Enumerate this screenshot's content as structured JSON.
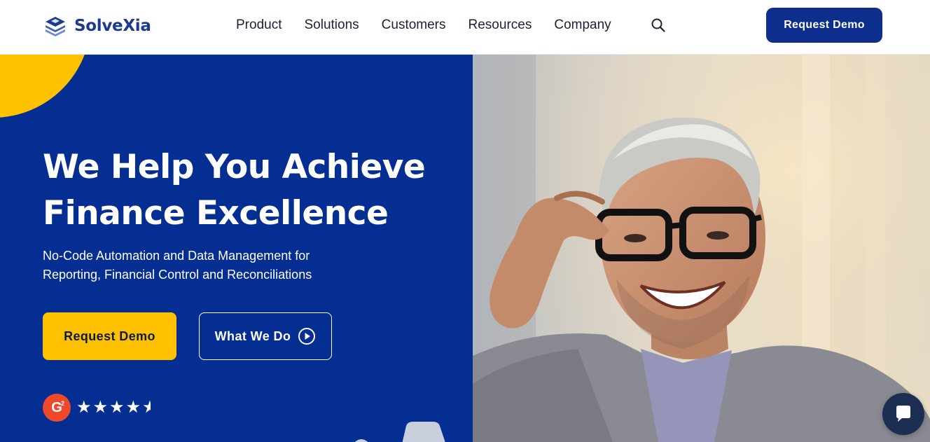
{
  "brand": {
    "name": "SolveXia",
    "logo_icon": "stacked-layers-logo",
    "color": "#1e3a8f"
  },
  "nav": {
    "items": [
      {
        "label": "Product"
      },
      {
        "label": "Solutions"
      },
      {
        "label": "Customers"
      },
      {
        "label": "Resources"
      },
      {
        "label": "Company"
      }
    ],
    "search_icon": "search-icon"
  },
  "header": {
    "cta_label": "Request Demo",
    "cta_color": "#0d2e8c"
  },
  "hero": {
    "title_line1": "We Help You Achieve",
    "title_line2": "Finance Excellence",
    "subtitle": "No-Code Automation and Data Management for Reporting, Financial Control and Reconciliations",
    "primary_cta": "Request Demo",
    "secondary_cta": "What We Do",
    "secondary_cta_icon": "play-circle-icon",
    "background_color": "#042e91",
    "accent_color": "#ffc100"
  },
  "rating": {
    "badge_text": "G",
    "badge_sup": "2",
    "stars": 4.5,
    "badge_color": "#f0492a"
  },
  "photo": {
    "subject": "smiling-man-with-glasses"
  },
  "chat": {
    "icon": "chat-bubble-icon"
  }
}
